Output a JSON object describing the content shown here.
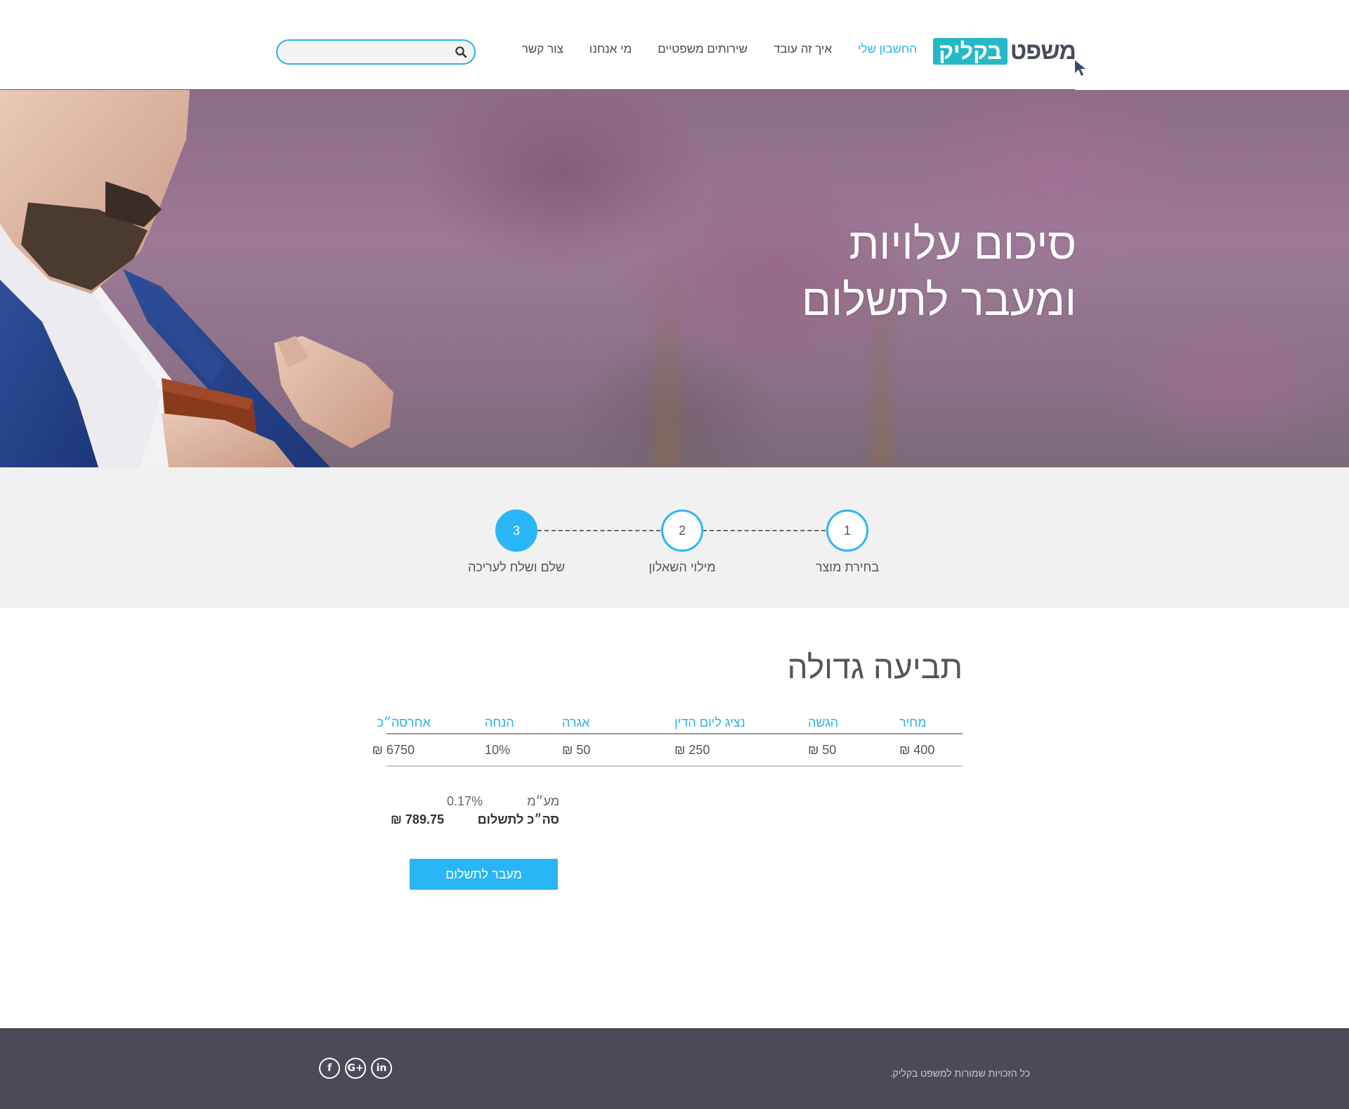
{
  "header": {
    "logo": {
      "dark_part": "משפט",
      "box_part": "בקליק"
    },
    "nav": [
      {
        "label": "החשבון שלי",
        "active": true
      },
      {
        "label": "איך זה עובד",
        "active": false
      },
      {
        "label": "שירותים משפטיים",
        "active": false
      },
      {
        "label": "מי אנחנו",
        "active": false
      },
      {
        "label": "צור קשר",
        "active": false
      }
    ],
    "search": {
      "placeholder": "",
      "value": ""
    }
  },
  "hero": {
    "title_line1": "סיכום עלויות",
    "title_line2": "ומעבר לתשלום"
  },
  "steps": [
    {
      "number": "1",
      "label": "בחירת מוצר",
      "active": false
    },
    {
      "number": "2",
      "label": "מילוי השאלון",
      "active": false
    },
    {
      "number": "3",
      "label": "שלם ושלח לעריכה",
      "active": true
    }
  ],
  "summary": {
    "product_title": "תביעה גדולה",
    "columns": [
      "מחיר",
      "הגשה",
      "נציג ליום הדין",
      "אגרה",
      "הנחה",
      "אחר",
      "סה״כ"
    ],
    "values": [
      "400 ₪",
      "50 ₪",
      "250 ₪",
      "50 ₪",
      "10%",
      "0",
      "675 ₪"
    ],
    "vat_label": "מע״מ",
    "vat_value": "0.17%",
    "total_label": "סה״כ לתשלום",
    "total_value": "789.75 ₪",
    "pay_button": "מעבר לתשלום"
  },
  "footer": {
    "copyright": "כל הזכויות שמורות למשפט בקליק.",
    "socials": [
      {
        "icon": "facebook-icon",
        "glyph": "f"
      },
      {
        "icon": "google-plus-icon",
        "glyph": "G+"
      },
      {
        "icon": "linkedin-icon",
        "glyph": "in"
      }
    ]
  },
  "colors": {
    "accent": "#29b6f6",
    "logo_box": "#25b9c6",
    "logo_text": "#474b5c",
    "footer_bg": "#4a4b57",
    "steps_bg": "#f1f1f1"
  }
}
